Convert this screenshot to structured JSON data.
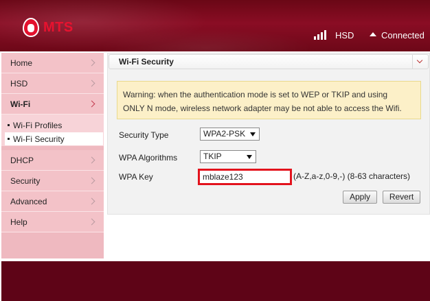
{
  "brand": {
    "name": "MTS"
  },
  "status": {
    "network_type": "HSD",
    "connection": "Connected",
    "signal_bars": 4,
    "signal_bars_max": 4
  },
  "sidebar": {
    "items": [
      {
        "label": "Home"
      },
      {
        "label": "HSD"
      },
      {
        "label": "Wi-Fi",
        "active": true
      },
      {
        "label": "DHCP"
      },
      {
        "label": "Security"
      },
      {
        "label": "Advanced"
      },
      {
        "label": "Help"
      }
    ],
    "wifi_sub": [
      {
        "label": "Wi-Fi Profiles"
      },
      {
        "label": "Wi-Fi Security",
        "active": true
      }
    ]
  },
  "main": {
    "title": "Wi-Fi Security",
    "warning_line1": "Warning: when the authentication mode is set to WEP or TKIP and using",
    "warning_line2": "ONLY N mode, wireless network adapter may be not able to access the Wifi.",
    "security_type_label": "Security Type",
    "security_type_value": "WPA2-PSK",
    "wpa_algorithms_label": "WPA Algorithms",
    "wpa_algorithms_value": "TKIP",
    "wpa_key_label": "WPA Key",
    "wpa_key_value": "mblaze123",
    "wpa_key_hint": "(A-Z,a-z,0-9,-) (8-63 characters)",
    "apply_label": "Apply",
    "revert_label": "Revert"
  },
  "colors": {
    "header": "#7a0a1f",
    "footer": "#5e0417",
    "sidebar": "#f3c2c8",
    "warning_bg": "#fcf0c8",
    "highlight": "#e3121c"
  }
}
